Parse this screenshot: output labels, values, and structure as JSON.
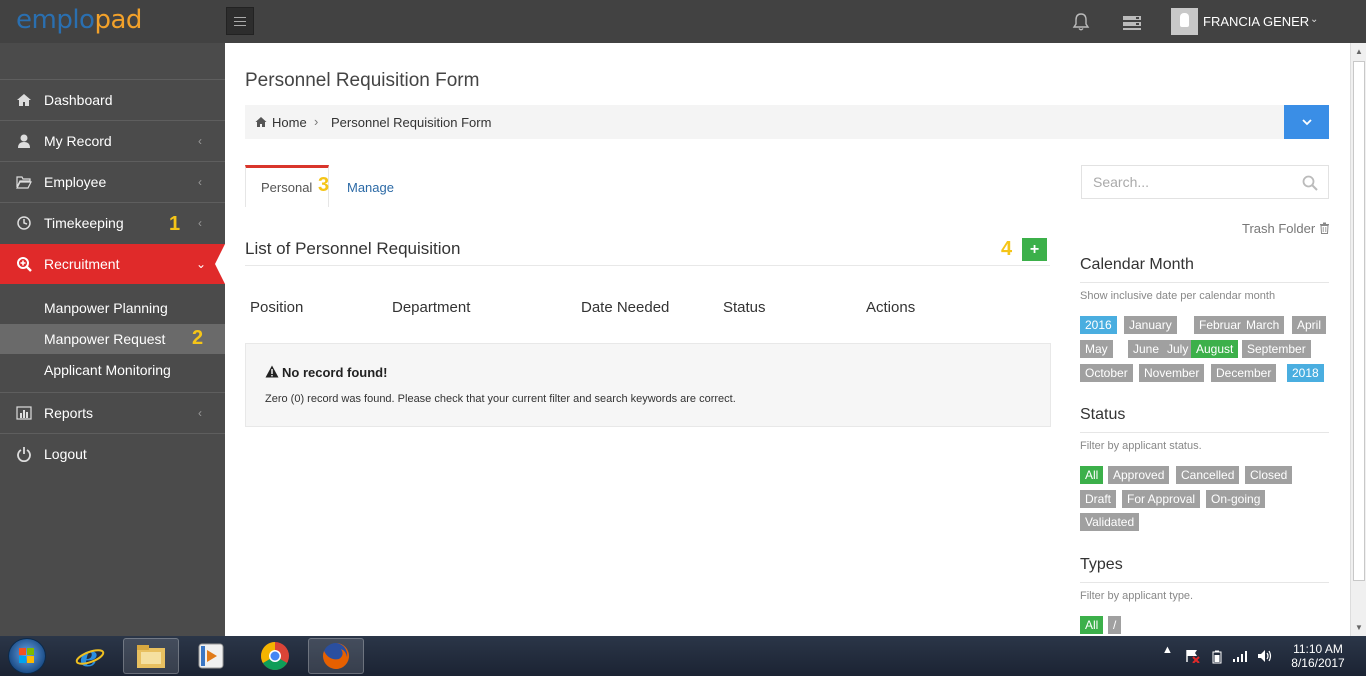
{
  "app": {
    "logo_part1": "emplo",
    "logo_part2": "pad",
    "user_name": "FRANCIA GENER"
  },
  "sidebar": {
    "items": [
      {
        "label": "Dashboard",
        "icon": "home-icon"
      },
      {
        "label": "My Record",
        "icon": "user-icon"
      },
      {
        "label": "Employee",
        "icon": "folder-icon"
      },
      {
        "label": "Timekeeping",
        "icon": "clock-icon"
      },
      {
        "label": "Recruitment",
        "icon": "search-plus-icon"
      },
      {
        "label": "Reports",
        "icon": "bar-chart-icon"
      },
      {
        "label": "Logout",
        "icon": "power-icon"
      }
    ],
    "subitems": [
      {
        "label": "Manpower Planning"
      },
      {
        "label": "Manpower Request"
      },
      {
        "label": "Applicant Monitoring"
      }
    ]
  },
  "annotations": {
    "a1": "1",
    "a2": "2",
    "a3": "3",
    "a4": "4"
  },
  "page": {
    "title": "Personnel Requisition Form",
    "breadcrumb": {
      "home": "Home",
      "current": "Personnel Requisition Form"
    }
  },
  "tabs": [
    {
      "label": "Personal"
    },
    {
      "label": "Manage"
    }
  ],
  "list": {
    "title": "List of Personnel Requisition",
    "add_label": "+",
    "columns": [
      "Position",
      "Department",
      "Date Needed",
      "Status",
      "Actions"
    ],
    "empty_title": "No record found!",
    "empty_message": "Zero (0) record was found. Please check that your current filter and search keywords are correct."
  },
  "right_panel": {
    "search_placeholder": "Search...",
    "trash_label": "Trash Folder",
    "calendar": {
      "title": "Calendar Month",
      "subtitle": "Show inclusive date per calendar month",
      "tags": [
        "2016",
        "January",
        "February",
        "March",
        "April",
        "May",
        "June",
        "July",
        "August",
        "September",
        "October",
        "November",
        "December",
        "2018"
      ]
    },
    "status": {
      "title": "Status",
      "subtitle": "Filter by applicant status.",
      "tags": [
        "All",
        "Approved",
        "Cancelled",
        "Closed",
        "Draft",
        "For Approval",
        "On-going",
        "Validated"
      ]
    },
    "types": {
      "title": "Types",
      "subtitle": "Filter by applicant type.",
      "tags": [
        "All",
        "/"
      ]
    }
  },
  "taskbar": {
    "time": "11:10 AM",
    "date": "8/16/2017"
  },
  "colors": {
    "accent_red": "#e02a2a",
    "sidebar_bg": "#4b4b4b",
    "topbar_bg": "#424242",
    "green": "#3cb04a",
    "blue": "#4aaee0",
    "gray_tag": "#a0a0a0"
  }
}
